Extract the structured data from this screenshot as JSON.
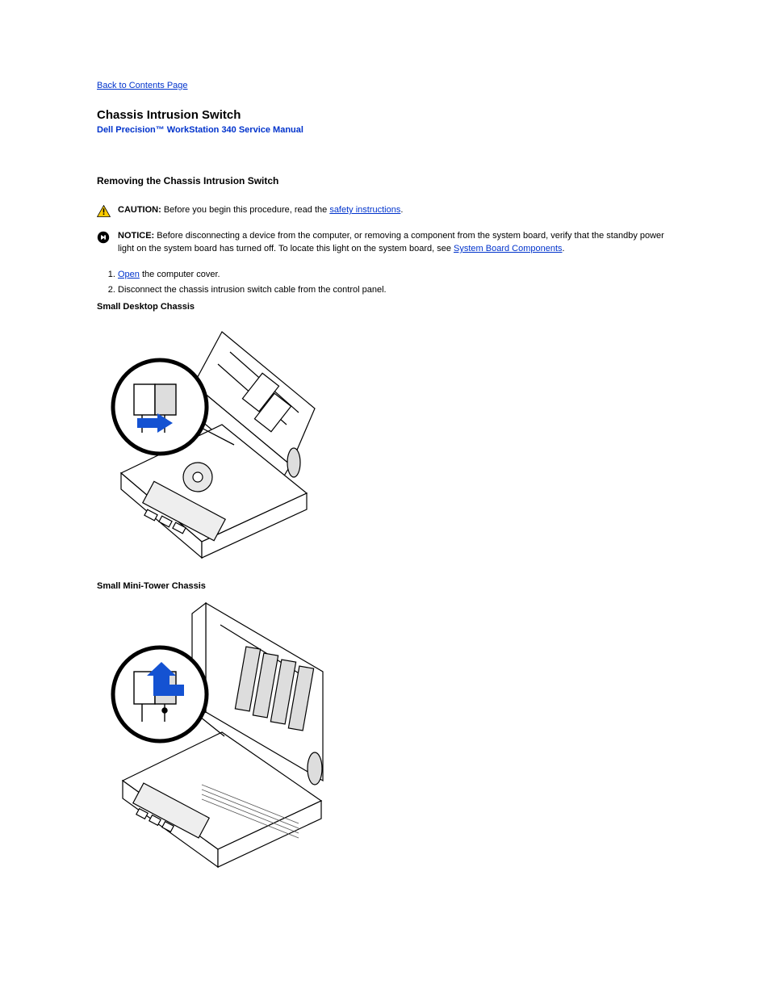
{
  "nav": {
    "back": "Back to Contents Page"
  },
  "header": {
    "title": "Chassis Intrusion Switch",
    "subtitle": "Dell Precision™ WorkStation 340 Service Manual"
  },
  "section1": {
    "heading": "Removing the Chassis Intrusion Switch"
  },
  "caution": {
    "label": "CAUTION:",
    "before": "Before you begin this procedure, read the ",
    "link": "safety instructions",
    "after": "."
  },
  "notice": {
    "label": "NOTICE:",
    "before": "Before disconnecting a device from the computer, or removing a component from the system board, verify that the standby power light on the system board has turned off. To locate this light on the system board, see ",
    "link": "System Board Components",
    "after": "."
  },
  "steps": {
    "item1_before": "Open",
    "item1_link": " the computer cover",
    "item1_after": ".",
    "item2": "Disconnect the chassis intrusion switch cable from the control panel."
  },
  "fig1": {
    "caption": "Small Desktop Chassis"
  },
  "fig2": {
    "caption": "Small Mini-Tower Chassis"
  }
}
